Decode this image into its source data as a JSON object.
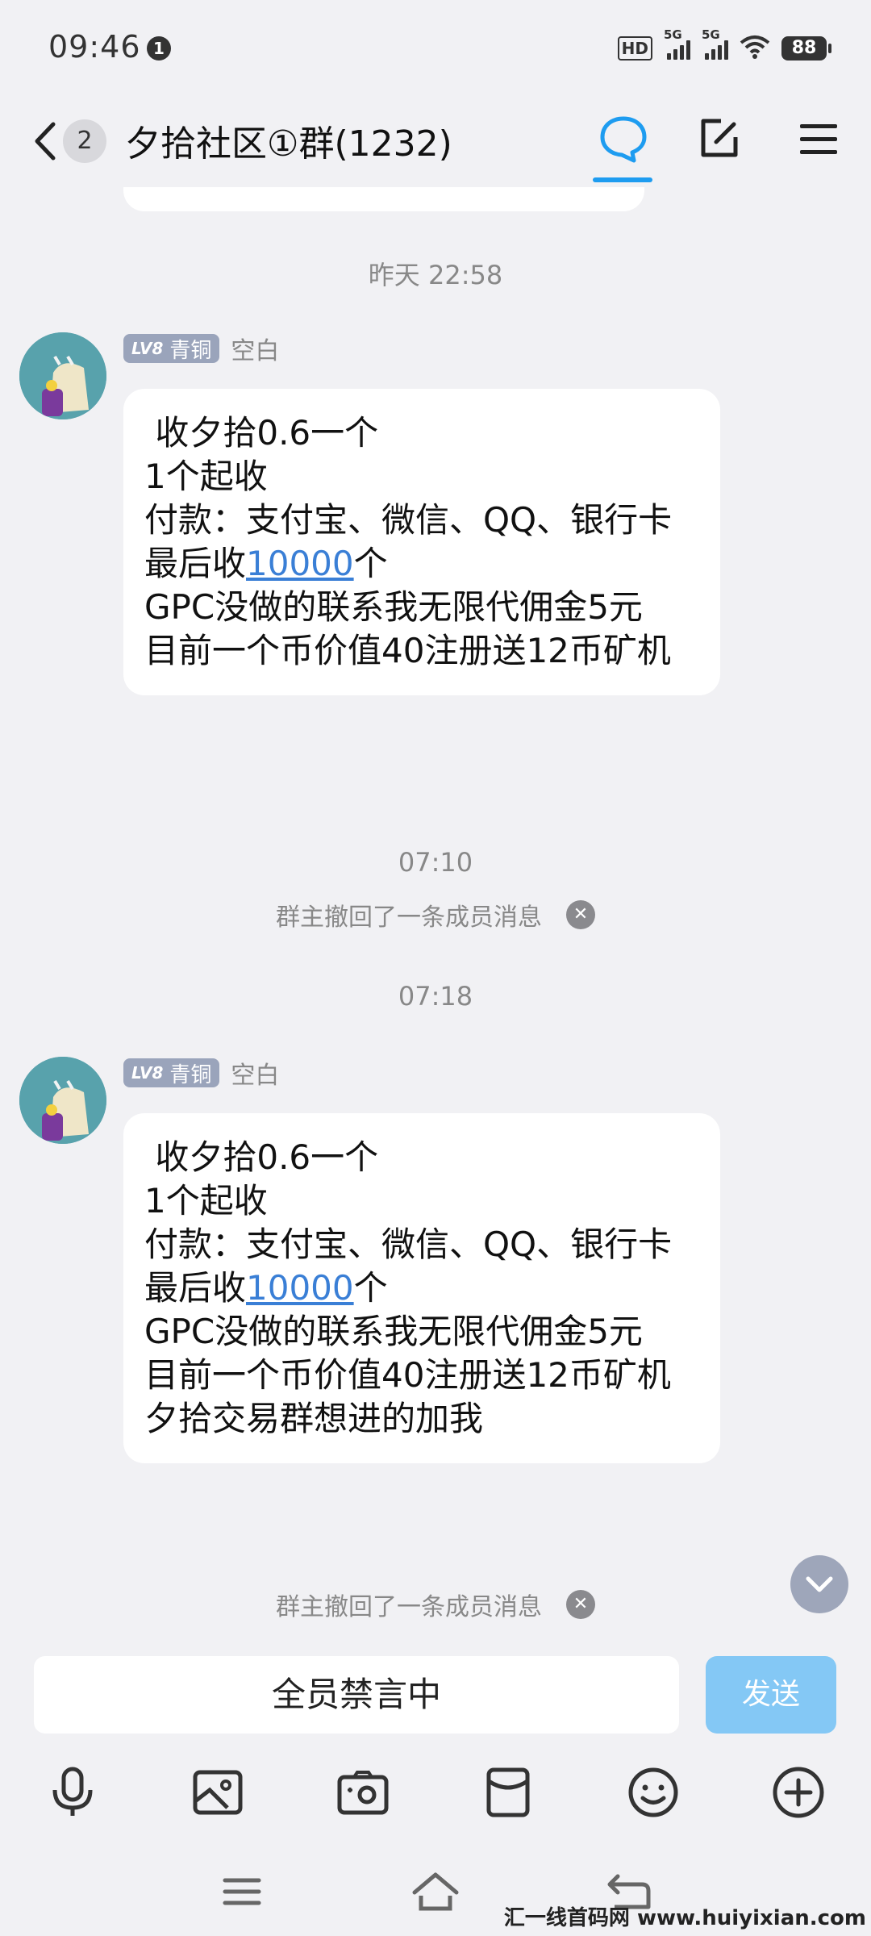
{
  "status_bar": {
    "time": "09:46",
    "notification_count": "1",
    "hd_label": "HD",
    "sim1_label": "5G",
    "sim2_label": "5G",
    "battery": "88"
  },
  "header": {
    "back_count": "2",
    "title": "夕拾社区①群(1232)"
  },
  "chat": {
    "time_1": "昨天 22:58",
    "time_2": "07:10",
    "time_3": "07:18",
    "recall_text": "群主撤回了一条成员消息",
    "messages": [
      {
        "level": "LV8",
        "rank": "青铜",
        "sender": "空白",
        "lines": [
          " 收夕拾0.6一个",
          "1个起收",
          "付款：支付宝、微信、QQ、银行卡",
          "最后收",
          "10000",
          "个",
          "GPC没做的联系我无限代佣金5元",
          "目前一个币价值40注册送12币矿机"
        ]
      },
      {
        "level": "LV8",
        "rank": "青铜",
        "sender": "空白",
        "lines": [
          " 收夕拾0.6一个",
          "1个起收",
          "付款：支付宝、微信、QQ、银行卡",
          "最后收",
          "10000",
          "个",
          "GPC没做的联系我无限代佣金5元",
          "目前一个币价值40注册送12币矿机",
          "夕拾交易群想进的加我"
        ]
      }
    ]
  },
  "input": {
    "muted_text": "全员禁言中",
    "send_label": "发送"
  },
  "toolbar_icons": [
    "microphone-icon",
    "image-icon",
    "camera-icon",
    "red-packet-icon",
    "emoji-icon",
    "plus-icon"
  ],
  "watermark": "汇一线首码网 www.huiyixian.com",
  "colors": {
    "accent": "#1e9cf0",
    "link": "#3a7fd6",
    "send_disabled": "#84c8f5",
    "level_badge": "#9aa4bb"
  }
}
